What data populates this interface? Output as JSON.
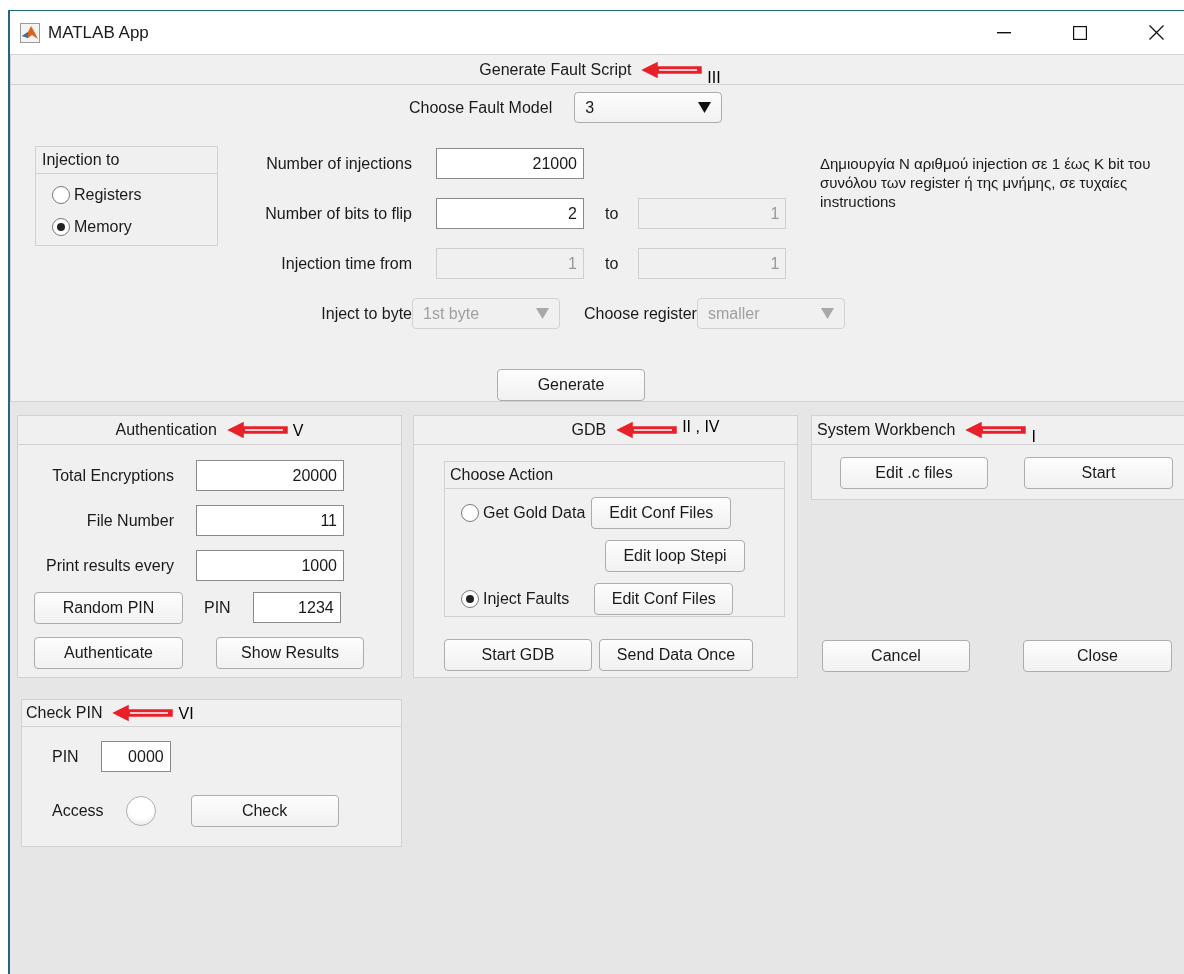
{
  "window": {
    "title": "MATLAB App"
  },
  "fault_script": {
    "title": "Generate Fault Script",
    "annotation": "III",
    "fault_model": {
      "label": "Choose Fault Model",
      "value": "3"
    },
    "injection_to": {
      "title": "Injection to",
      "options": [
        {
          "label": "Registers",
          "selected": false
        },
        {
          "label": "Memory",
          "selected": true
        }
      ]
    },
    "rows": [
      {
        "label": "Number of injections",
        "value": "21000",
        "disabled": false
      },
      {
        "label": "Number of bits to flip",
        "value": "2",
        "disabled": false,
        "to": {
          "label": "to",
          "value": "1",
          "disabled": true
        }
      },
      {
        "label": "Injection time from",
        "value": "1",
        "disabled": true,
        "to": {
          "label": "to",
          "value": "1",
          "disabled": true
        }
      }
    ],
    "inject_to_byte": {
      "label": "Inject to byte",
      "value": "1st byte",
      "disabled": true
    },
    "choose_register": {
      "label": "Choose register",
      "value": "smaller",
      "disabled": true
    },
    "description": "Δημιουργία Ν αριθμού injection σε 1 έως Κ bit του συνόλου των register ή της μνήμης, σε τυχαίες instructions",
    "generate_button": "Generate"
  },
  "authentication": {
    "title": "Authentication",
    "annotation": "V",
    "fields": [
      {
        "label": "Total Encryptions",
        "value": "20000"
      },
      {
        "label": "File Number",
        "value": "11"
      },
      {
        "label": "Print results every",
        "value": "1000"
      }
    ],
    "random_pin_button": "Random PIN",
    "pin": {
      "label": "PIN",
      "value": "1234"
    },
    "buttons": [
      "Authenticate",
      "Show Results"
    ]
  },
  "gdb": {
    "title": "GDB",
    "annotation": "II , IV",
    "choose_action": {
      "title": "Choose Action",
      "options": [
        {
          "label": "Get Gold Data",
          "selected": false
        },
        {
          "label": "Inject Faults",
          "selected": true
        }
      ],
      "buttons": [
        "Edit Conf Files",
        "Edit loop Stepi",
        "Edit Conf Files"
      ]
    },
    "buttons": [
      "Start GDB",
      "Send Data Once"
    ]
  },
  "system_workbench": {
    "title": "System Workbench",
    "annotation": "I",
    "buttons": [
      "Edit .c files",
      "Start"
    ]
  },
  "dialog_buttons": [
    "Cancel",
    "Close"
  ],
  "check_pin": {
    "title": "Check PIN",
    "annotation": "VI",
    "pin": {
      "label": "PIN",
      "value": "0000"
    },
    "access": {
      "label": "Access",
      "on": false
    },
    "check_button": "Check"
  }
}
